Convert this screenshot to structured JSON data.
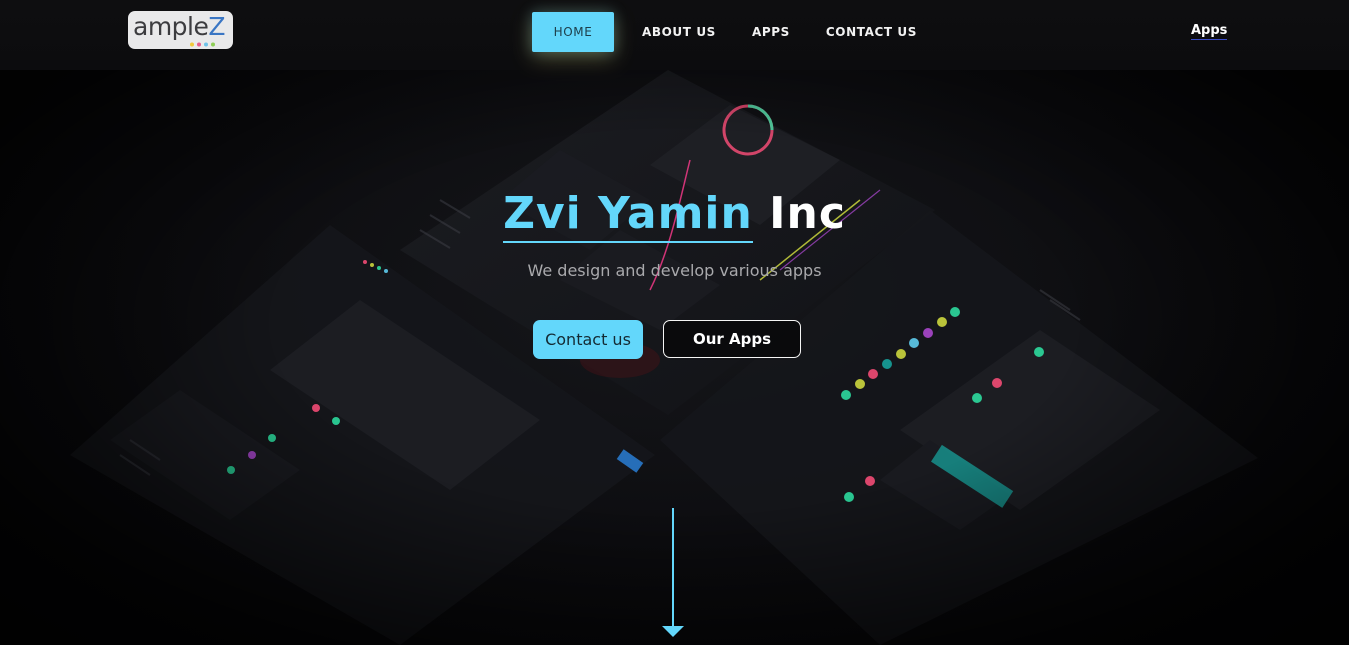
{
  "logo": {
    "text_main": "ample",
    "text_accent": "Z"
  },
  "nav": {
    "items": [
      {
        "label": "HOME"
      },
      {
        "label": "ABOUT US"
      },
      {
        "label": "APPS"
      },
      {
        "label": "CONTACT US"
      }
    ],
    "right_link": "Apps"
  },
  "hero": {
    "title_accent": "Zvi Yamin",
    "title_rest": " Inc",
    "subtitle": "We design and develop various apps",
    "primary_button": "Contact us",
    "secondary_button": "Our Apps"
  },
  "colors": {
    "accent": "#63d7fb",
    "background": "#0b0b0d",
    "text": "#ffffff"
  },
  "icons": {
    "scroll": "arrow-down-icon"
  }
}
